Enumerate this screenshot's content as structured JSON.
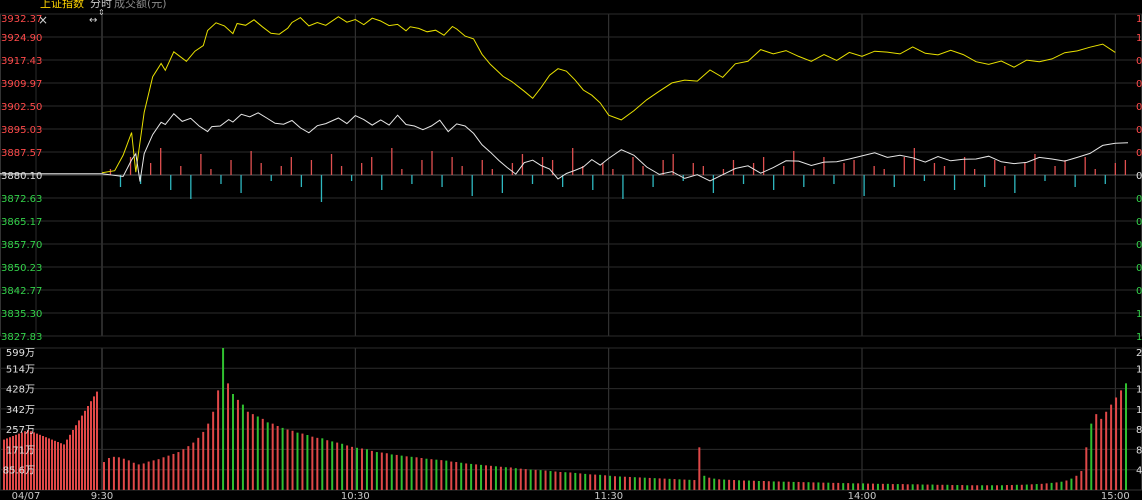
{
  "header": {
    "title": "上证指数",
    "tab": "分时",
    "subtitle": "成交额(元)"
  },
  "controls": {
    "close_glyph": "×",
    "resize_glyph": "↔",
    "marker_glyph": "⇕"
  },
  "chart_data": [
    {
      "type": "line",
      "name": "price-panel",
      "ylim": [
        3827.83,
        3932.37
      ],
      "y_ticks": [
        "3932.37",
        "3924.90",
        "3917.43",
        "3909.97",
        "3902.50",
        "3895.03",
        "3887.57",
        "3880.10",
        "3872.63",
        "3865.17",
        "3857.70",
        "3850.23",
        "3842.77",
        "3835.30",
        "3827.83"
      ],
      "baseline": 3880.1,
      "right_ticks": [
        "1",
        "1",
        "0",
        "0",
        "0",
        "0",
        "0",
        "0",
        "0",
        "0",
        "0",
        "0",
        "0",
        "1",
        "1"
      ],
      "grid": true,
      "series": [
        {
          "color": "#e8e000",
          "x": [
            0,
            3,
            5,
            7,
            8,
            10,
            12,
            14,
            15,
            17,
            20,
            22,
            24,
            25,
            27,
            29,
            31,
            32,
            34,
            36,
            38,
            40,
            42,
            44,
            45,
            47,
            49,
            51,
            53,
            56,
            58,
            60,
            62,
            64,
            66,
            68,
            70,
            72,
            73,
            75,
            77,
            79,
            81,
            83,
            84,
            86,
            88,
            90,
            92,
            94,
            95,
            97,
            100,
            102,
            104,
            106,
            108,
            110,
            112,
            114,
            116,
            118,
            120,
            123,
            126,
            129,
            132,
            135,
            138,
            141,
            144,
            147,
            150,
            153,
            156,
            159,
            162,
            165,
            168,
            171,
            174,
            177,
            180,
            183,
            186,
            189,
            192,
            195,
            198,
            201,
            204,
            207,
            210,
            213,
            216,
            219,
            222,
            225,
            228,
            231,
            234,
            237,
            240
          ],
          "values": [
            3880.8,
            3881.5,
            3886.5,
            3893.9,
            3881.0,
            3900.5,
            3912.0,
            3916.3,
            3914.1,
            3920.1,
            3917.0,
            3920.3,
            3922.1,
            3927.0,
            3929.5,
            3928.5,
            3926.0,
            3929.3,
            3928.7,
            3930.5,
            3928.2,
            3926.1,
            3925.8,
            3927.8,
            3929.6,
            3931.2,
            3928.5,
            3929.6,
            3928.7,
            3931.5,
            3929.7,
            3930.6,
            3928.9,
            3931.0,
            3930.1,
            3928.6,
            3929.0,
            3926.9,
            3928.2,
            3927.7,
            3926.6,
            3927.1,
            3925.5,
            3928.3,
            3927.5,
            3925.2,
            3924.3,
            3919.3,
            3916.0,
            3913.4,
            3912.1,
            3910.5,
            3907.3,
            3905.0,
            3908.5,
            3912.5,
            3914.6,
            3913.8,
            3911.0,
            3907.7,
            3906.0,
            3903.5,
            3899.5,
            3898.0,
            3901.0,
            3904.5,
            3907.3,
            3910.0,
            3910.9,
            3910.6,
            3914.2,
            3911.8,
            3916.2,
            3917.0,
            3920.8,
            3919.4,
            3920.5,
            3918.6,
            3917.0,
            3919.2,
            3917.3,
            3919.9,
            3918.6,
            3920.3,
            3920.0,
            3919.4,
            3921.7,
            3919.6,
            3919.1,
            3920.6,
            3919.2,
            3916.9,
            3916.0,
            3917.1,
            3915.1,
            3917.4,
            3916.9,
            3917.8,
            3919.8,
            3920.4,
            3921.6,
            3922.6,
            3919.9
          ]
        },
        {
          "color": "#e6e6e6",
          "x": [
            0,
            5,
            7,
            8,
            9,
            10,
            12,
            14,
            15,
            17,
            19,
            21,
            23,
            25,
            26,
            28,
            30,
            31,
            33,
            35,
            37,
            39,
            41,
            43,
            45,
            47,
            49,
            51,
            53,
            56,
            58,
            60,
            62,
            64,
            66,
            68,
            70,
            72,
            74,
            76,
            78,
            80,
            82,
            84,
            86,
            88,
            90,
            92,
            94,
            96,
            98,
            100,
            102,
            104,
            106,
            108,
            110,
            112,
            114,
            116,
            118,
            120,
            123,
            126,
            129,
            132,
            135,
            138,
            141,
            144,
            147,
            150,
            153,
            156,
            159,
            162,
            165,
            168,
            171,
            174,
            177,
            180,
            183,
            186,
            189,
            192,
            195,
            198,
            201,
            204,
            207,
            210,
            213,
            216,
            219,
            222,
            225,
            228,
            231,
            234,
            237,
            240,
            243
          ],
          "values": [
            3880.5,
            3879.6,
            3885.0,
            3887.0,
            3878.0,
            3887.0,
            3893.2,
            3897.2,
            3896.5,
            3900.0,
            3897.5,
            3898.5,
            3896.0,
            3894.2,
            3895.8,
            3896.0,
            3898.1,
            3897.3,
            3899.8,
            3899.0,
            3900.3,
            3898.6,
            3896.9,
            3896.6,
            3897.8,
            3895.4,
            3893.8,
            3896.1,
            3896.8,
            3898.6,
            3896.8,
            3899.4,
            3898.1,
            3896.3,
            3898.0,
            3896.3,
            3899.5,
            3896.5,
            3896.0,
            3894.8,
            3896.0,
            3897.9,
            3894.2,
            3896.7,
            3896.0,
            3893.6,
            3889.9,
            3887.5,
            3884.8,
            3882.5,
            3880.4,
            3884.1,
            3884.9,
            3883.2,
            3882.0,
            3878.8,
            3880.6,
            3881.6,
            3882.7,
            3885.1,
            3883.3,
            3885.5,
            3888.3,
            3886.5,
            3882.7,
            3880.3,
            3881.2,
            3879.0,
            3880.2,
            3878.2,
            3880.2,
            3882.2,
            3883.1,
            3880.7,
            3882.5,
            3884.7,
            3884.6,
            3883.2,
            3884.3,
            3884.4,
            3885.3,
            3886.3,
            3887.3,
            3885.8,
            3886.5,
            3885.7,
            3884.3,
            3886.1,
            3884.7,
            3885.2,
            3885.3,
            3886.2,
            3884.4,
            3883.8,
            3884.2,
            3885.8,
            3885.3,
            3884.6,
            3885.8,
            3887.1,
            3889.7,
            3890.4,
            3890.6
          ]
        }
      ],
      "flow_bars": [
        0.2,
        -0.4,
        0.6,
        -0.3,
        0.4,
        0.9,
        -0.5,
        0.3,
        -0.8,
        0.7,
        0.2,
        -0.3,
        0.5,
        -0.6,
        0.8,
        0.4,
        -0.2,
        0.3,
        0.6,
        -0.4,
        0.5,
        -0.9,
        0.7,
        0.3,
        -0.2,
        0.4,
        0.6,
        -0.5,
        0.9,
        0.2,
        -0.3,
        0.5,
        0.8,
        -0.4,
        0.6,
        0.3,
        -0.7,
        0.5,
        0.2,
        -0.6,
        0.4,
        0.7,
        -0.3,
        0.6,
        0.5,
        -0.4,
        0.9,
        0.3,
        -0.5,
        0.4,
        0.2,
        -0.8,
        0.6,
        0.3,
        -0.4,
        0.5,
        0.7,
        -0.2,
        0.4,
        0.3,
        -0.6,
        0.2,
        0.5,
        -0.3,
        0.4,
        0.6,
        -0.5,
        0.3,
        0.8,
        -0.4,
        0.2,
        0.6,
        -0.3,
        0.4,
        0.5,
        -0.7,
        0.3,
        0.2,
        -0.4,
        0.6,
        0.9,
        -0.2,
        0.4,
        0.3,
        -0.5,
        0.6,
        0.2,
        -0.4,
        0.5,
        0.3,
        -0.6,
        0.4,
        0.7,
        -0.2,
        0.3,
        0.5,
        -0.4,
        0.6,
        0.2,
        -0.3,
        0.4,
        0.5
      ]
    },
    {
      "type": "bar",
      "name": "volume-panel",
      "ylim": [
        0,
        599
      ],
      "y_ticks": [
        "599万",
        "514万",
        "428万",
        "342万",
        "257万",
        "171万",
        "85.6万"
      ],
      "right_ticks": [
        "2",
        "1",
        "1",
        "1",
        "8",
        "8",
        "4"
      ],
      "x_ticks": [
        "04/07",
        "9:30",
        "10:30",
        "11:30",
        "14:00",
        "15:00"
      ],
      "values": [
        118,
        135,
        140,
        138,
        132,
        125,
        115,
        108,
        112,
        120,
        125,
        130,
        138,
        145,
        152,
        160,
        172,
        185,
        200,
        220,
        245,
        280,
        330,
        420,
        599,
        450,
        405,
        380,
        360,
        330,
        320,
        310,
        300,
        285,
        280,
        270,
        262,
        255,
        250,
        242,
        238,
        232,
        225,
        220,
        218,
        210,
        205,
        200,
        195,
        188,
        182,
        178,
        175,
        172,
        165,
        160,
        158,
        155,
        150,
        148,
        145,
        142,
        140,
        138,
        135,
        132,
        130,
        128,
        126,
        124,
        120,
        118,
        115,
        112,
        110,
        108,
        106,
        104,
        102,
        100,
        98,
        96,
        95,
        92,
        90,
        88,
        86,
        85,
        84,
        82,
        80,
        78,
        76,
        75,
        74,
        72,
        70,
        68,
        66,
        65,
        64,
        62,
        60,
        58,
        57,
        56,
        55,
        54,
        53,
        52,
        51,
        50,
        49,
        48,
        47,
        46,
        45,
        44,
        43,
        42,
        180,
        60,
        52,
        48,
        45,
        44,
        43,
        42,
        41,
        40,
        40,
        39,
        38,
        38,
        37,
        36,
        36,
        35,
        35,
        34,
        34,
        33,
        33,
        32,
        32,
        31,
        31,
        30,
        30,
        29,
        29,
        28,
        28,
        28,
        27,
        27,
        26,
        26,
        26,
        25,
        25,
        25,
        24,
        24,
        24,
        23,
        23,
        23,
        22,
        22,
        22,
        21,
        21,
        21,
        20,
        20,
        20,
        20,
        20,
        20,
        20,
        20,
        21,
        21,
        22,
        22,
        23,
        24,
        25,
        26,
        28,
        30,
        32,
        35,
        40,
        48,
        60,
        80,
        180,
        280,
        320,
        300,
        330,
        360,
        390,
        420,
        450
      ],
      "up": [
        1,
        1,
        1,
        1,
        1,
        1,
        1,
        1,
        1,
        1,
        1,
        1,
        1,
        1,
        1,
        1,
        1,
        1,
        1,
        1,
        1,
        1,
        1,
        1,
        0,
        1,
        0,
        1,
        0,
        1,
        1,
        0,
        1,
        0,
        1,
        1,
        0,
        1,
        1,
        0,
        1,
        0,
        1,
        1,
        0,
        1,
        0,
        1,
        0,
        1,
        1,
        0,
        1,
        0,
        1,
        0,
        1,
        1,
        0,
        1,
        0,
        1,
        0,
        1,
        1,
        0,
        1,
        0,
        1,
        0,
        1,
        1,
        0,
        1,
        0,
        1,
        0,
        1,
        1,
        0,
        1,
        0,
        1,
        0,
        1,
        1,
        0,
        1,
        0,
        1,
        0,
        1,
        1,
        0,
        1,
        0,
        1,
        0,
        1,
        1,
        0,
        1,
        0,
        1,
        0,
        1,
        1,
        0,
        1,
        0,
        1,
        0,
        1,
        1,
        0,
        1,
        0,
        1,
        0,
        1,
        1,
        0,
        1,
        0,
        1,
        0,
        1,
        1,
        0,
        1,
        0,
        1,
        0,
        1,
        1,
        0,
        1,
        0,
        1,
        0,
        1,
        1,
        0,
        1,
        0,
        1,
        0,
        1,
        1,
        0,
        1,
        0,
        1,
        0,
        1,
        1,
        0,
        1,
        0,
        1,
        0,
        1,
        1,
        0,
        1,
        0,
        1,
        0,
        1,
        1,
        0,
        1,
        0,
        1,
        0,
        1,
        1,
        0,
        1,
        0,
        1,
        0,
        1,
        1,
        0,
        1,
        0,
        1,
        0,
        1,
        1,
        0,
        1,
        0,
        1,
        0,
        1,
        1,
        1,
        0,
        1,
        1,
        1,
        1,
        1,
        1
      ]
    }
  ]
}
